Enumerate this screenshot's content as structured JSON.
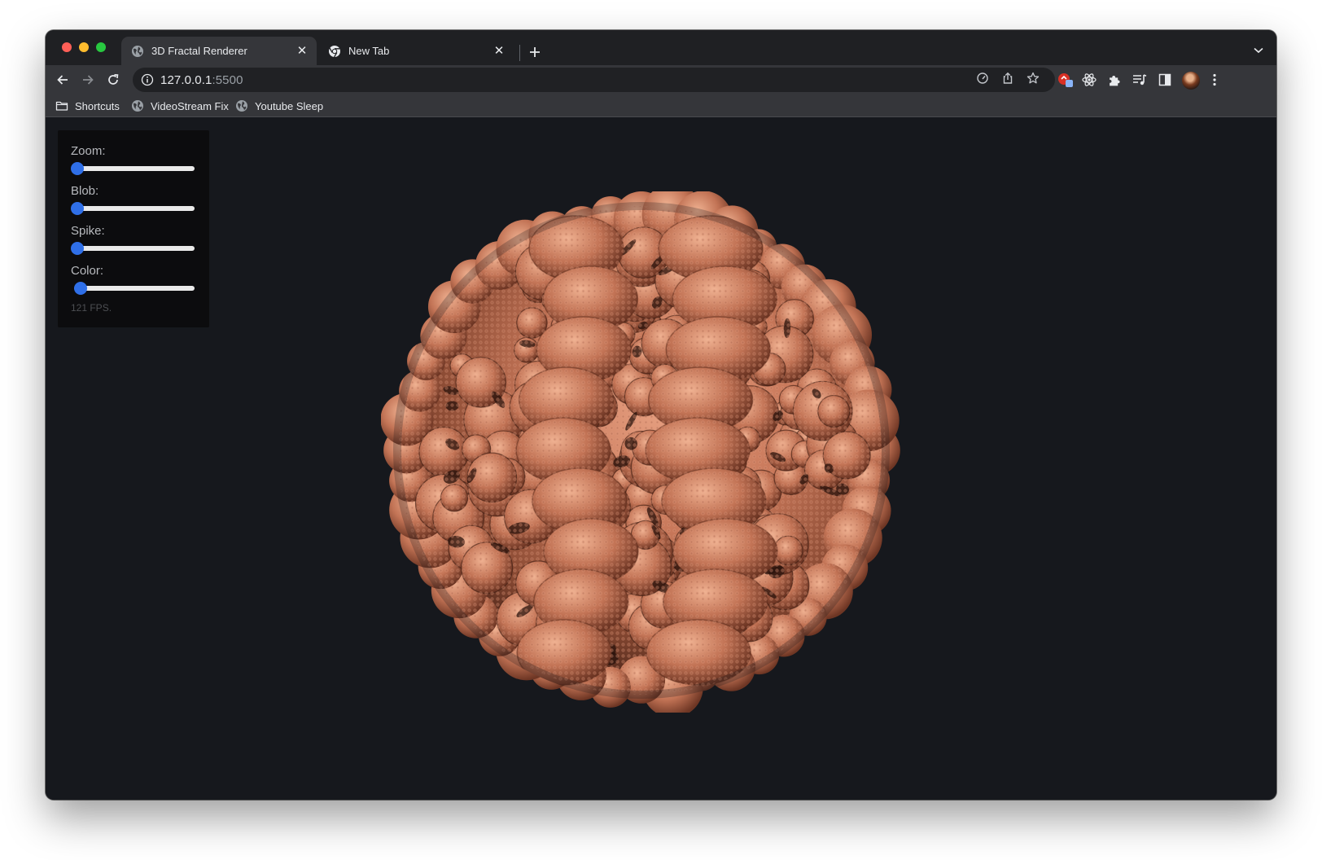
{
  "browser": {
    "tabs": [
      {
        "title": "3D Fractal Renderer",
        "active": true
      },
      {
        "title": "New Tab",
        "active": false
      }
    ],
    "url_host": "127.0.0.1",
    "url_port": ":5500",
    "bookmarks": [
      {
        "label": "Shortcuts",
        "icon": "folder-icon"
      },
      {
        "label": "VideoStream Fix",
        "icon": "globe-icon"
      },
      {
        "label": "Youtube Sleep",
        "icon": "globe-icon"
      }
    ]
  },
  "controls": {
    "zoom": {
      "label": "Zoom:",
      "value": 0
    },
    "blob": {
      "label": "Blob:",
      "value": 0
    },
    "spike": {
      "label": "Spike:",
      "value": 0
    },
    "color": {
      "label": "Color:",
      "value": 0.03
    },
    "fps_text": "121 FPS."
  },
  "colors": {
    "fractal": "#c8785a",
    "slider_thumb": "#2f6fe8",
    "page_bg": "#16181d"
  }
}
